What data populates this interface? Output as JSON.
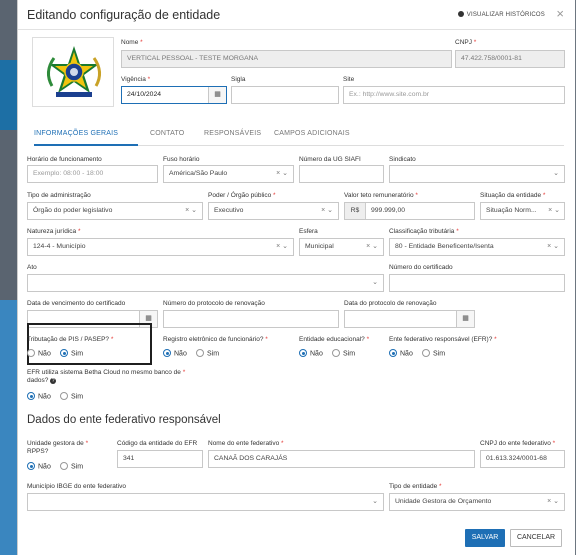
{
  "modal": {
    "title": "Editando configuração de entidade",
    "history_label": "VISUALIZAR HISTÓRICOS",
    "close": "×"
  },
  "header_fields": {
    "nome": {
      "label": "Nome",
      "value": "VERTICAL PESSOAL - TESTE MORGANA"
    },
    "cnpj": {
      "label": "CNPJ",
      "value": "47.422.758/0001-81"
    },
    "vigencia": {
      "label": "Vigência",
      "value": "24/10/2024"
    },
    "sigla": {
      "label": "Sigla",
      "value": ""
    },
    "site": {
      "label": "Site",
      "placeholder": "Ex.: http://www.site.com.br"
    }
  },
  "tabs": [
    {
      "label": "INFORMAÇÕES GERAIS",
      "active": true
    },
    {
      "label": "CONTATO",
      "active": false
    },
    {
      "label": "RESPONSÁVEIS",
      "active": false
    },
    {
      "label": "CAMPOS ADICIONAIS",
      "active": false
    }
  ],
  "fields": {
    "horario": {
      "label": "Horário de funcionamento",
      "placeholder": "Exemplo: 08:00 - 18:00"
    },
    "fuso": {
      "label": "Fuso horário",
      "value": "América/São Paulo"
    },
    "siafi": {
      "label": "Número da UG SIAFI",
      "value": ""
    },
    "sindicato": {
      "label": "Sindicato",
      "value": ""
    },
    "tipo_admin": {
      "label": "Tipo de administração",
      "value": "Órgão do poder legislativo"
    },
    "poder": {
      "label": "Poder / Órgão público",
      "value": "Executivo"
    },
    "teto": {
      "label": "Valor teto remuneratório",
      "prefix": "R$",
      "value": "999.999,00"
    },
    "situacao": {
      "label": "Situação da entidade",
      "value": "Situação Norm..."
    },
    "natureza": {
      "label": "Natureza jurídica",
      "value": "124-4 - Município"
    },
    "esfera": {
      "label": "Esfera",
      "value": "Municipal"
    },
    "classificacao": {
      "label": "Classificação tributária",
      "value": "80 - Entidade Beneficente/Isenta"
    },
    "ato": {
      "label": "Ato",
      "value": ""
    },
    "num_cert": {
      "label": "Número do certificado",
      "value": ""
    },
    "venc_cert": {
      "label": "Data de vencimento do certificado",
      "value": ""
    },
    "num_protocolo": {
      "label": "Número do protocolo de renovação",
      "value": ""
    },
    "data_protocolo": {
      "label": "Data do protocolo de renovação",
      "value": ""
    }
  },
  "radios": {
    "pis": {
      "label": "Tributação de PIS / PASEP?",
      "no": "Não",
      "yes": "Sim",
      "selected": "Sim"
    },
    "registro": {
      "label": "Registro eletrônico de funcionário?",
      "no": "Não",
      "yes": "Sim",
      "selected": "Não"
    },
    "educacional": {
      "label": "Entidade educacional?",
      "no": "Não",
      "yes": "Sim",
      "selected": "Não"
    },
    "efr": {
      "label": "Ente federativo responsável (EFR)?",
      "no": "Não",
      "yes": "Sim",
      "selected": "Não"
    },
    "betha": {
      "label_line1": "EFR utiliza sistema Betha Cloud no mesmo banco de",
      "label_line2": "dados?",
      "no": "Não",
      "yes": "Sim",
      "selected": "Não"
    },
    "gestora": {
      "label_line1": "Unidade gestora de",
      "label_line2": "RPPS?",
      "no": "Não",
      "yes": "Sim",
      "selected": "Não"
    }
  },
  "efr_section": {
    "title": "Dados do ente federativo responsável",
    "codigo": {
      "label": "Código da entidade do EFR",
      "value": "341"
    },
    "nome": {
      "label": "Nome do ente federativo",
      "value": "CANAÃ DOS CARAJÁS"
    },
    "cnpj": {
      "label": "CNPJ do ente federativo",
      "value": "01.613.324/0001-68"
    },
    "municipio": {
      "label": "Município IBGE do ente federativo",
      "value": ""
    },
    "tipo": {
      "label": "Tipo de entidade",
      "value": "Unidade Gestora de Orçamento"
    }
  },
  "actions": {
    "save": "SALVAR",
    "cancel": "CANCELAR"
  },
  "colors": {
    "accent": "#1e6fb5",
    "required": "#e53935",
    "highlight_border": "#1f1f1f"
  }
}
